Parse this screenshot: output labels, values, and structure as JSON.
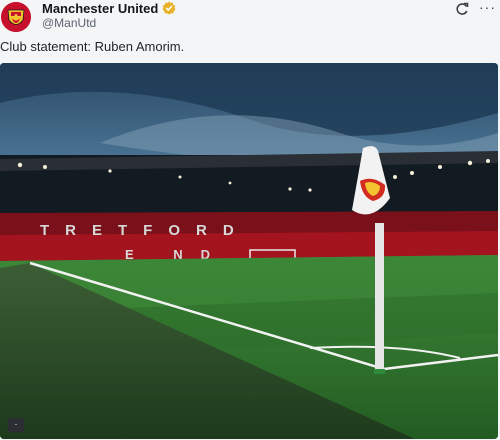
{
  "post": {
    "author_name": "Manchester United",
    "author_handle": "@ManUtd",
    "text": "Club statement: Ruben Amorim.",
    "media_corner_label": "·",
    "image": {
      "stand_lettering": "TRETFORD",
      "stand_lettering_lower": "E ND"
    }
  },
  "icons": {
    "avatar": "man-utd-crest-icon",
    "verified": "verified-badge-icon",
    "refresh": "refresh-icon",
    "more": "more-dots-icon"
  },
  "colors": {
    "brand_red": "#c7102e",
    "verified_gold": "#e8b32b",
    "pitch_green": "#2f7a2f"
  }
}
